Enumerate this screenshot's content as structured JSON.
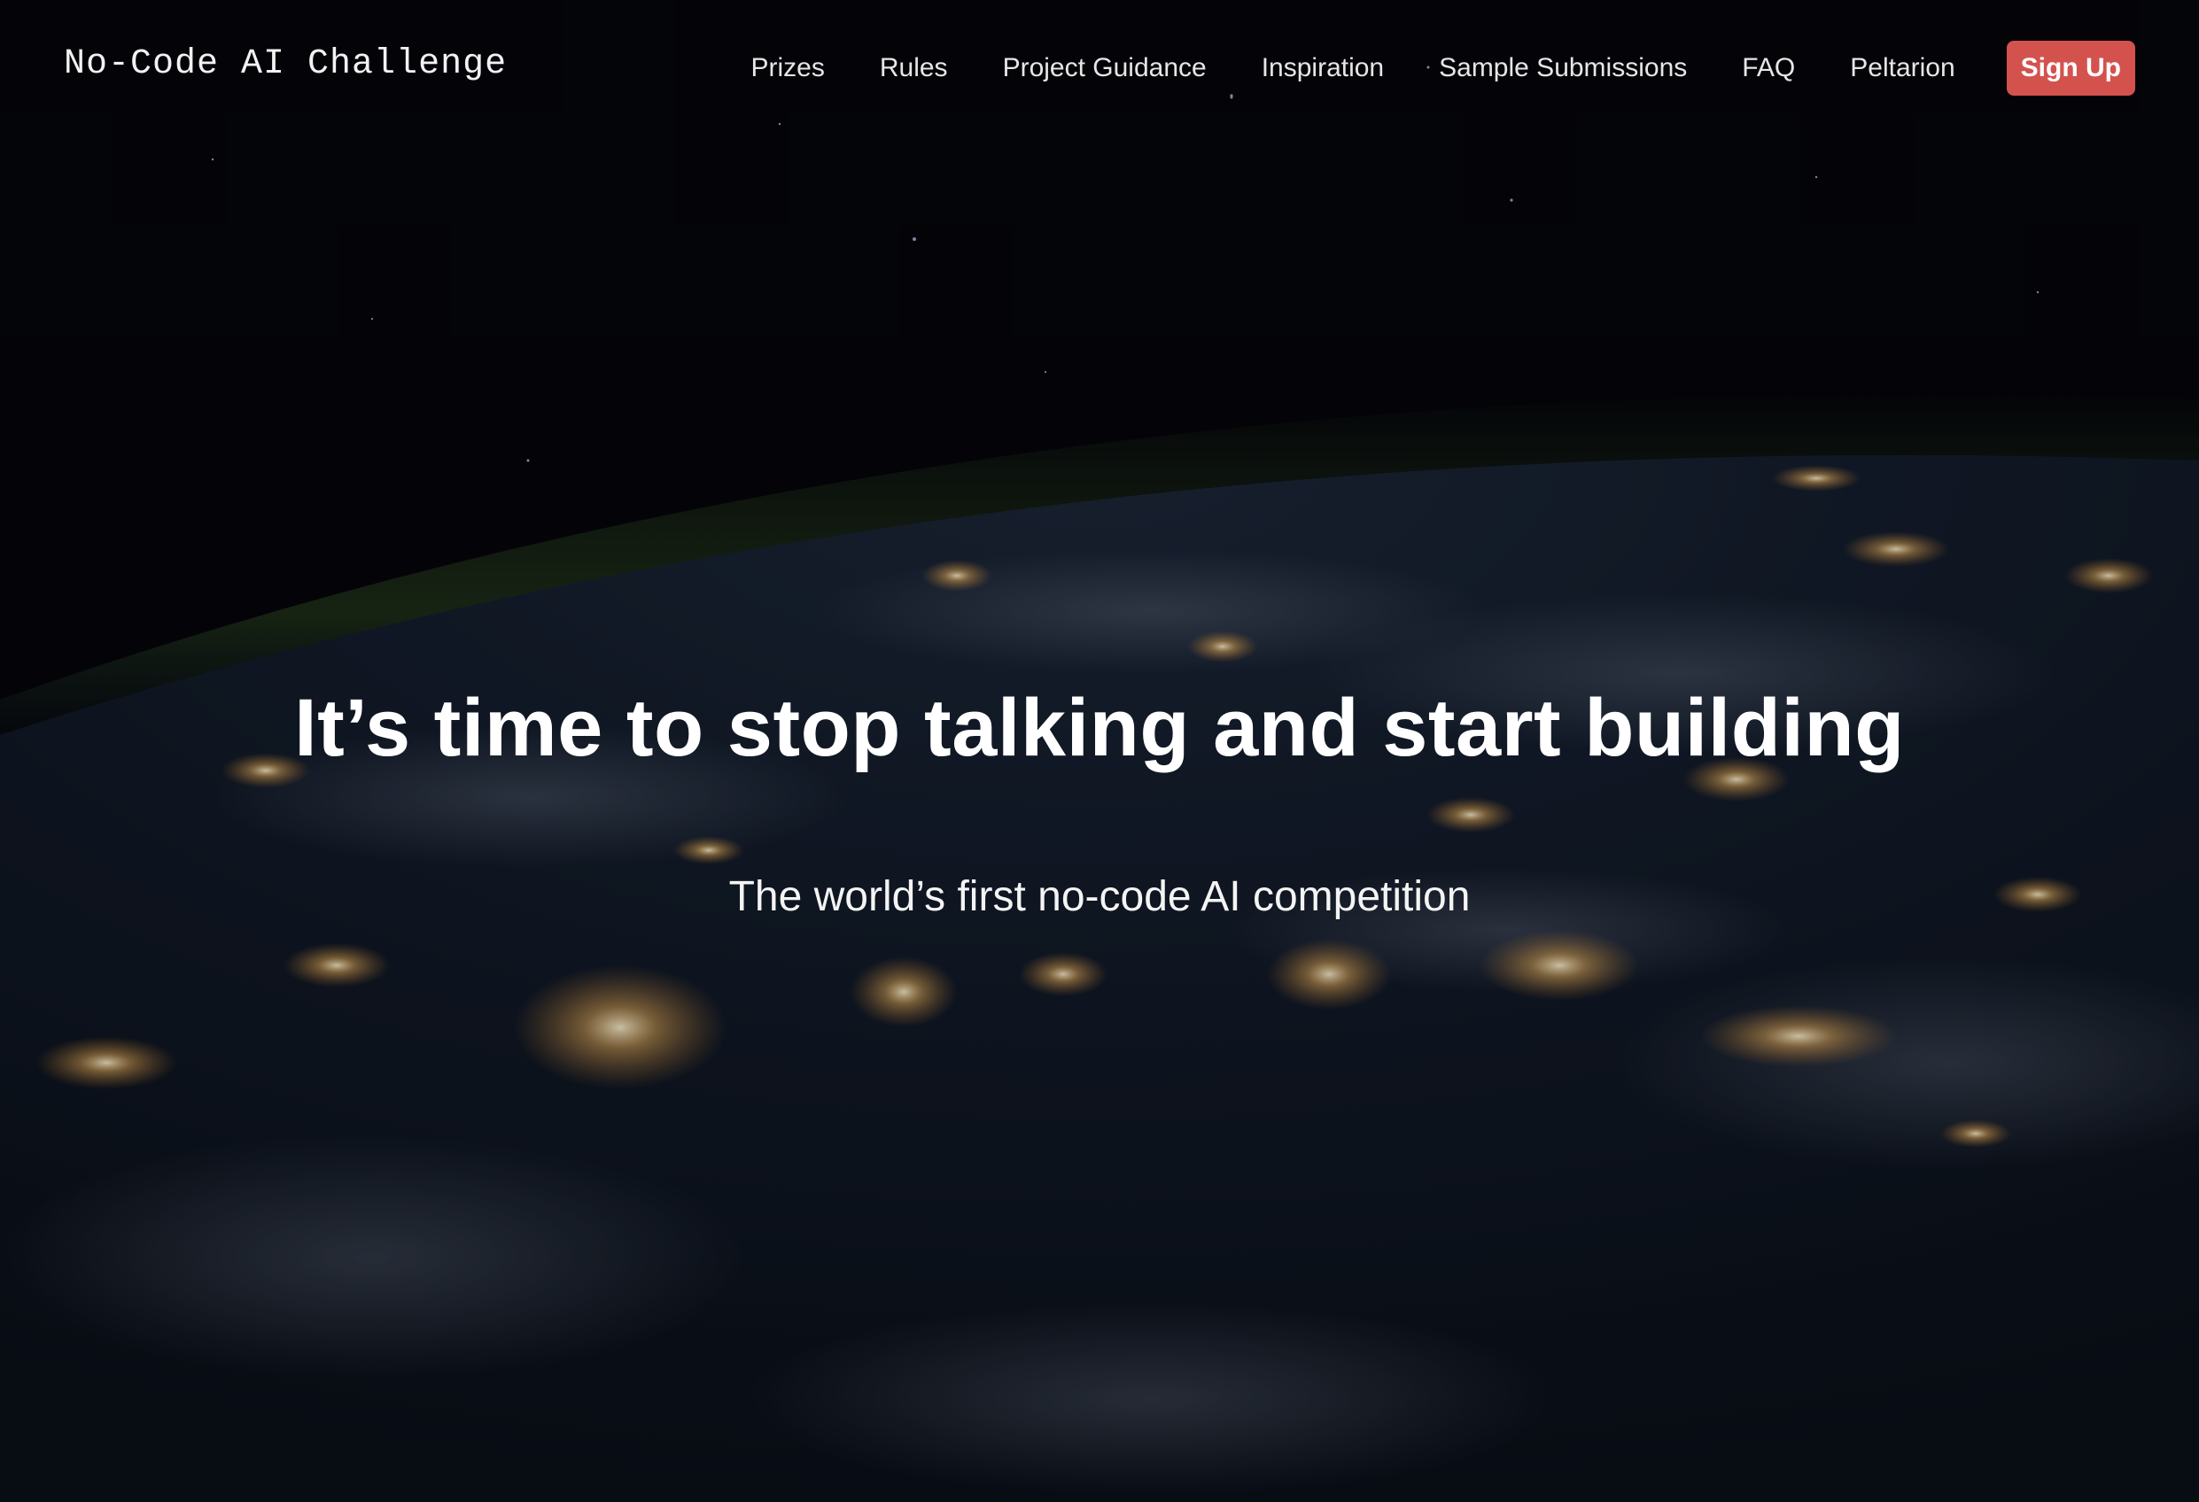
{
  "nav": {
    "brand": "No-Code AI Challenge",
    "links": [
      {
        "label": "Prizes"
      },
      {
        "label": "Rules"
      },
      {
        "label": "Project Guidance"
      },
      {
        "label": "Inspiration"
      },
      {
        "label": "Sample Submissions"
      },
      {
        "label": "FAQ"
      },
      {
        "label": "Peltarion"
      }
    ],
    "cta_label": "Sign Up"
  },
  "hero": {
    "headline": "It’s time to stop talking and start building",
    "subheadline": "The world’s first no-code AI competition",
    "background": "earth-at-night-from-space"
  },
  "colors": {
    "cta": "#d4524e",
    "background": "#05060a"
  }
}
